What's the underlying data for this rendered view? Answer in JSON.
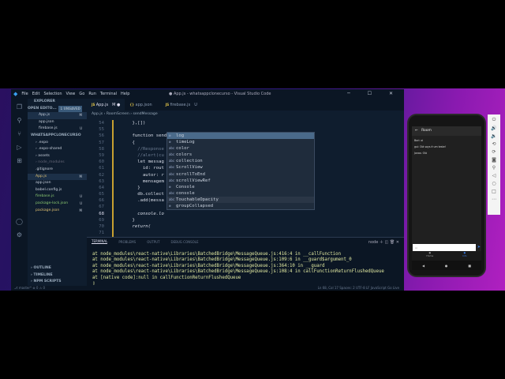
{
  "window": {
    "title": "● App.js - whatsappclonecurso - Visual Studio Code",
    "controls": "─ ☐ ✕"
  },
  "menu": [
    "File",
    "Edit",
    "Selection",
    "View",
    "Go",
    "Run",
    "Terminal",
    "Help"
  ],
  "sidebar": {
    "header": "EXPLORER",
    "open_editors": "OPEN EDITO...",
    "unsaved": "1 UNSAVED",
    "open_files": [
      {
        "name": "App.js",
        "badge": "M"
      },
      {
        "name": "app.json",
        "badge": ""
      },
      {
        "name": "firebase.js",
        "badge": "U"
      }
    ],
    "project": "WHATSAPPCLONECURSO",
    "tree": [
      {
        "name": "› .expo",
        "badge": ""
      },
      {
        "name": "› .expo-shared",
        "badge": ""
      },
      {
        "name": "› assets",
        "badge": ""
      },
      {
        "name": "› node_modules",
        "badge": ""
      },
      {
        "name": ".gitignore",
        "badge": ""
      },
      {
        "name": "App.js",
        "badge": "M"
      },
      {
        "name": "app.json",
        "badge": ""
      },
      {
        "name": "babel.config.js",
        "badge": ""
      },
      {
        "name": "firebase.js",
        "badge": "U"
      },
      {
        "name": "package-lock.json",
        "badge": "U"
      },
      {
        "name": "package.json",
        "badge": "M"
      }
    ],
    "bottom": [
      "› OUTLINE",
      "› TIMELINE",
      "› NPM SCRIPTS"
    ]
  },
  "tabs": [
    {
      "label": "App.js",
      "badge": "M ●",
      "active": true
    },
    {
      "label": "app.json",
      "badge": ""
    },
    {
      "label": "firebase.js",
      "badge": "U"
    }
  ],
  "breadcrumb": "App.js › RoomScreen › sendMessage",
  "code": [
    {
      "n": "54",
      "t": "    },[])"
    },
    {
      "n": "55",
      "t": ""
    },
    {
      "n": "56",
      "t": "    function sendMessage(){"
    },
    {
      "n": "57",
      "t": "    {"
    },
    {
      "n": "58",
      "t": "      //Response"
    },
    {
      "n": "59",
      "t": "      //alert(cu                                   route.params.id);"
    },
    {
      "n": "60",
      "t": "      let messag"
    },
    {
      "n": "61",
      "t": "        id: rout"
    },
    {
      "n": "62",
      "t": "        autor: r"
    },
    {
      "n": "63",
      "t": "        mensagem"
    },
    {
      "n": "64",
      "t": "      }"
    },
    {
      "n": "65",
      "t": "      db.collect                                 ('messages')"
    },
    {
      "n": "66",
      "t": "      .add(messa"
    },
    {
      "n": "67",
      "t": ""
    },
    {
      "n": "68",
      "t": "      console.lo",
      "cur": true
    },
    {
      "n": "69",
      "t": "    }"
    },
    {
      "n": "70",
      "t": "    return("
    },
    {
      "n": "71",
      "t": ""
    }
  ],
  "suggestions": [
    {
      "icon": "⚙",
      "label": "log"
    },
    {
      "icon": "⚙",
      "label": "timeLog"
    },
    {
      "icon": "abc",
      "label": "color"
    },
    {
      "icon": "abc",
      "label": "colors"
    },
    {
      "icon": "abc",
      "label": "collection"
    },
    {
      "icon": "abc",
      "label": "ScrollView"
    },
    {
      "icon": "abc",
      "label": "scrollToEnd"
    },
    {
      "icon": "abc",
      "label": "scrollViewRef"
    },
    {
      "icon": "⚙",
      "label": "Console"
    },
    {
      "icon": "abc",
      "label": "console"
    },
    {
      "icon": "abc",
      "label": "TouchableOpacity"
    },
    {
      "icon": "⚙",
      "label": "groupCollapsed"
    }
  ],
  "panel": {
    "tabs": [
      "TERMINAL",
      "PROBLEMS",
      "OUTPUT",
      "DEBUG CONSOLE"
    ],
    "shell": "node",
    "lines": [
      "at node_modules\\react-native\\Libraries\\BatchedBridge\\MessageQueue.js:416:4 in __callFunction",
      "at node_modules\\react-native\\Libraries\\BatchedBridge\\MessageQueue.js:109:6 in __guard$argument_0",
      "at node_modules\\react-native\\Libraries\\BatchedBridge\\MessageQueue.js:364:10 in __guard",
      "at node_modules\\react-native\\Libraries\\BatchedBridge\\MessageQueue.js:108:4 in callFunctionReturnFlushedQueue",
      "at [native code]:null in callFunctionReturnFlushedQueue",
      "▯"
    ]
  },
  "status": {
    "left": "⎇ master*  ⊗ 0 ⚠ 0",
    "right": "Ln 68, Col 17   Spaces: 2   UTF-8   LF   JavaScript   Go Live"
  },
  "phone": {
    "title": "Room",
    "messages": [
      "Bori: oi",
      "gui: Olá soys é um teste!",
      "Jonas: Olá"
    ],
    "input": "oi",
    "nav": [
      "Home",
      "Info"
    ]
  }
}
